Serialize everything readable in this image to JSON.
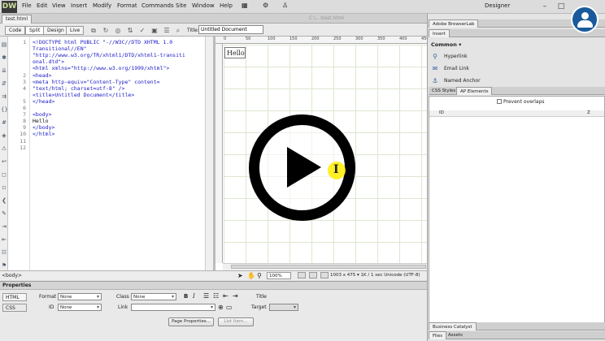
{
  "app": {
    "logo_text": "DW",
    "menus": [
      "File",
      "Edit",
      "View",
      "Insert",
      "Modify",
      "Format",
      "Commands",
      "Site",
      "Window",
      "Help"
    ],
    "workspace": "Designer",
    "window_buttons": [
      "–",
      "□",
      "✕"
    ]
  },
  "document": {
    "tab": "test.html",
    "path": "C:\\...\\test.html"
  },
  "toolbar": {
    "views": [
      "Code",
      "Split",
      "Design",
      "Live"
    ],
    "active_view": "Split",
    "title_label": "Title:",
    "title_value": "Untitled Document"
  },
  "code": {
    "line_numbers": [
      "1",
      "",
      "",
      "",
      "",
      "2",
      "3",
      "4",
      "",
      "5",
      "6",
      "7",
      "8",
      "9",
      "10",
      "11",
      "12"
    ],
    "lines": [
      {
        "text": "<!DOCTYPE html PUBLIC \"-//W3C//DTD XHTML 1.0",
        "color": "#1a1ac8"
      },
      {
        "text": "Transitional//EN\"",
        "color": "#1a1ac8"
      },
      {
        "text": "\"http://www.w3.org/TR/xhtml1/DTD/xhtml1-transiti",
        "color": "#1a1ac8"
      },
      {
        "text": "onal.dtd\">",
        "color": "#1a1ac8"
      },
      {
        "text": "<html xmlns=\"http://www.w3.org/1999/xhtml\">",
        "color": "#1a1ac8"
      },
      {
        "text": "<head>",
        "color": "#1a1ac8"
      },
      {
        "text": "<meta http-equiv=\"Content-Type\" content=",
        "color": "#1a1ac8"
      },
      {
        "text": "\"text/html; charset=utf-8\" />",
        "color": "#1a1ac8"
      },
      {
        "text": "<title>Untitled Document</title>",
        "color": "#1a1ac8"
      },
      {
        "text": "</head>",
        "color": "#1a1ac8"
      },
      {
        "text": "",
        "color": "#111"
      },
      {
        "text": "<body>",
        "color": "#1a1ac8"
      },
      {
        "text": "Hello",
        "color": "#111"
      },
      {
        "text": "</body>",
        "color": "#1a1ac8"
      },
      {
        "text": "</html>",
        "color": "#1a1ac8"
      }
    ]
  },
  "design": {
    "ruler_numbers": [
      "0",
      "50",
      "100",
      "150",
      "200",
      "250",
      "300",
      "350",
      "400",
      "450"
    ],
    "hello_text": "Hello"
  },
  "status": {
    "tag_path": "<body>",
    "zoom": "100%",
    "info": "1003 x 475 ▾  1K / 1 sec  Unicode (UTF-8)"
  },
  "properties": {
    "title": "Properties",
    "html_btn": "HTML",
    "css_btn": "CSS",
    "format_label": "Format",
    "format_value": "None",
    "class_label": "Class",
    "class_value": "None",
    "id_label": "ID",
    "id_value": "None",
    "link_label": "Link",
    "title_field_label": "Title",
    "target_label": "Target",
    "page_props_btn": "Page Properties...",
    "list_item_btn": "List Item..."
  },
  "right_panel": {
    "top_tab": "Adobe BrowserLab",
    "insert_tab": "Insert",
    "category": "Common",
    "items": [
      {
        "label": "Hyperlink",
        "icon": "hyperlink-icon",
        "glyph": "⚲"
      },
      {
        "label": "Email Link",
        "icon": "email-icon",
        "glyph": "✉"
      },
      {
        "label": "Named Anchor",
        "icon": "anchor-icon",
        "glyph": "⚓"
      }
    ],
    "css_tab": "CSS Styles",
    "ap_tab": "AP Elements",
    "prevent_overlaps": "Prevent overlaps",
    "col_id": "ID",
    "col_z": "Z",
    "business_tab": "Business Catalyst",
    "files_tab": "Files",
    "assets_tab": "Assets"
  }
}
